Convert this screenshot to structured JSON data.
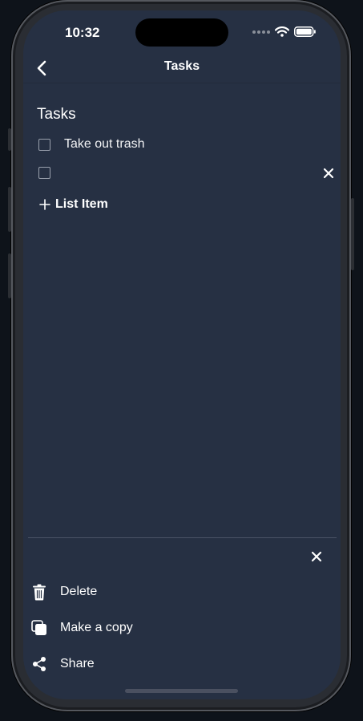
{
  "status_bar": {
    "time": "10:32"
  },
  "nav": {
    "title": "Tasks"
  },
  "list": {
    "title": "Tasks",
    "items": [
      {
        "text": "Take out trash",
        "checked": false
      },
      {
        "text": "",
        "checked": false
      }
    ],
    "add_label": "List Item"
  },
  "sheet": {
    "actions": [
      {
        "label": "Delete",
        "icon": "trash-icon"
      },
      {
        "label": "Make a copy",
        "icon": "copy-icon"
      },
      {
        "label": "Share",
        "icon": "share-icon"
      }
    ]
  },
  "colors": {
    "background": "#263043",
    "text": "#ffffff",
    "checkbox_border": "#9aa1ad",
    "divider": "#4a5366"
  }
}
